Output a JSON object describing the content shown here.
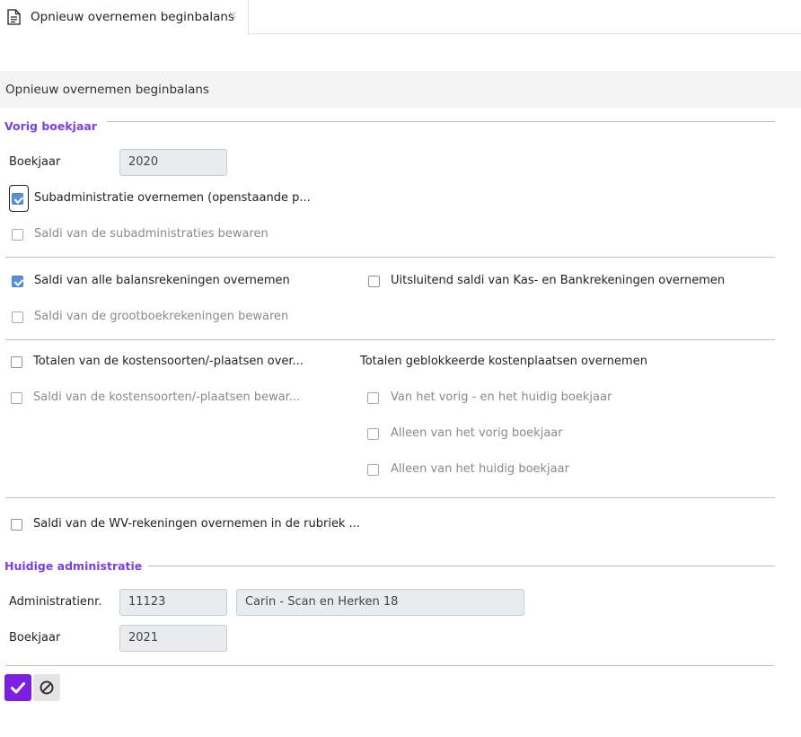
{
  "tab": {
    "icon": "document-icon",
    "label": "Opnieuw overnemen beginbalans",
    "close_icon": "close-icon"
  },
  "page_title": "Opnieuw overnemen beginbalans",
  "vorig_boekjaar": {
    "section_title": "Vorig boekjaar",
    "boekjaar_label": "Boekjaar",
    "boekjaar_value": "2020",
    "sub_overnemen": {
      "label": "Subadministratie overnemen (openstaande p...",
      "checked": true
    },
    "sub_saldi_bewaren": {
      "label": "Saldi van de subadministraties bewaren",
      "checked": false,
      "disabled": true
    },
    "balans_overnemen": {
      "label": "Saldi van alle balansrekeningen overnemen",
      "checked": true
    },
    "kas_bank": {
      "label": "Uitsluitend saldi van Kas- en Bankrekeningen overnemen",
      "checked": false
    },
    "grootboek_bewaren": {
      "label": "Saldi van de grootboekrekeningen bewaren",
      "checked": false,
      "disabled": true
    },
    "kostensoorten_totalen": {
      "label": "Totalen van de kostensoorten/-plaatsen over...",
      "checked": false
    },
    "kostensoorten_saldi": {
      "label": "Saldi van de kostensoorten/-plaatsen bewar...",
      "checked": false,
      "disabled": true
    },
    "geblokkeerd_title": "Totalen geblokkeerde kostenplaatsen overnemen",
    "geblokkeerd_options": [
      {
        "label": "Van het vorig - en het huidig boekjaar",
        "checked": false
      },
      {
        "label": "Alleen van het vorig boekjaar",
        "checked": false
      },
      {
        "label": "Alleen van het huidig boekjaar",
        "checked": false
      }
    ],
    "wv_rekeningen": {
      "label": "Saldi van de WV-rekeningen overnemen in de rubriek ...",
      "checked": false
    }
  },
  "huidige_administratie": {
    "section_title": "Huidige administratie",
    "admin_label": "Administratienr.",
    "admin_number": "11123",
    "admin_name": "Carin - Scan en Herken 18",
    "boekjaar_label": "Boekjaar",
    "boekjaar_value": "2021"
  },
  "buttons": {
    "ok_icon": "checkmark-icon",
    "cancel_icon": "cancel-icon"
  },
  "colors": {
    "accent": "#7b1fe0",
    "section_title": "#7b3fe4",
    "checkbox_checked": "#5b8fd8"
  }
}
